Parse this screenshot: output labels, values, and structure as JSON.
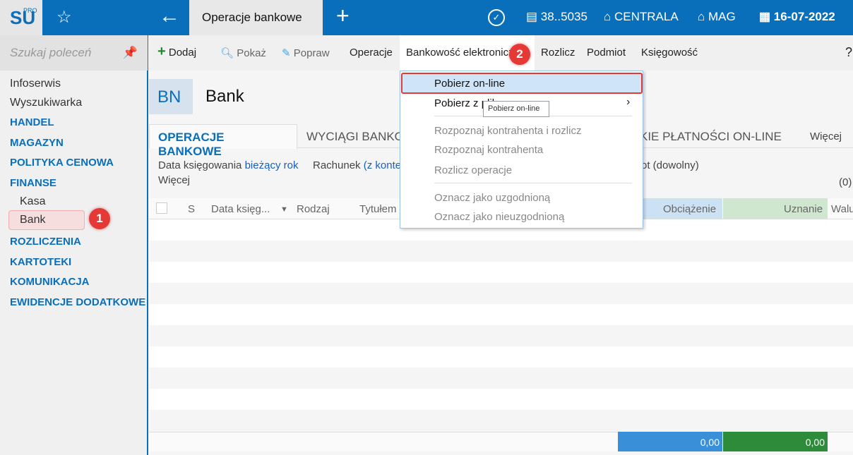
{
  "topbar": {
    "logo": "SU",
    "logo_sup": "PRO",
    "tab": "Operacje bankowe",
    "user": "38..5035",
    "center": "CENTRALA",
    "warehouse": "MAG",
    "date": "16-07-2022"
  },
  "sidebar": {
    "search_placeholder": "Szukaj poleceń",
    "items": [
      "Infoserwis",
      "Wyszukiwarka",
      "HANDEL",
      "MAGAZYN",
      "POLITYKA CENOWA",
      "FINANSE",
      "Kasa",
      "Bank",
      "ROZLICZENIA",
      "KARTOTEKI",
      "KOMUNIKACJA",
      "EWIDENCJE DODATKOWE"
    ]
  },
  "toolbar": {
    "add": "Dodaj",
    "show": "Pokaż",
    "edit": "Popraw",
    "operations": "Operacje",
    "ebanking": "Bankowość elektroniczna",
    "settle": "Rozlicz",
    "entity": "Podmiot",
    "accounting": "Księgowość",
    "help": "?"
  },
  "header": {
    "code": "BN",
    "title": "Bank"
  },
  "tabs": [
    "OPERACJE BANKOWE",
    "WYCIĄGI BANKOWE",
    "KIE PŁATNOŚCI ON-LINE",
    "Więcej"
  ],
  "filters": {
    "date_label": "Data księgowania",
    "date_value": "bieżący rok",
    "account_label": "Rachunek",
    "account_value": "(z konte",
    "other": "ot (dowolny)",
    "more": "Więcej",
    "count": "(0)"
  },
  "columns": [
    "S",
    "Data księg...",
    "Rodzaj",
    "Tytułem",
    "Obciążenie",
    "Uznanie",
    "Walu"
  ],
  "totals": {
    "debit": "0,00",
    "credit": "0,00"
  },
  "menu": {
    "items": [
      "Pobierz on-line",
      "Pobierz z pliku",
      "Rozpoznaj kontrahenta i rozlicz",
      "Rozpoznaj kontrahenta",
      "Rozlicz operacje",
      "Oznacz jako uzgodnioną",
      "Oznacz jako nieuzgodnioną"
    ],
    "tooltip": "Pobierz on-line"
  },
  "badges": [
    "1",
    "2"
  ],
  "colors": {
    "brand": "#0a6fba",
    "debit": "#3a8fd9",
    "credit": "#2e8b3a",
    "badge": "#e53935"
  }
}
